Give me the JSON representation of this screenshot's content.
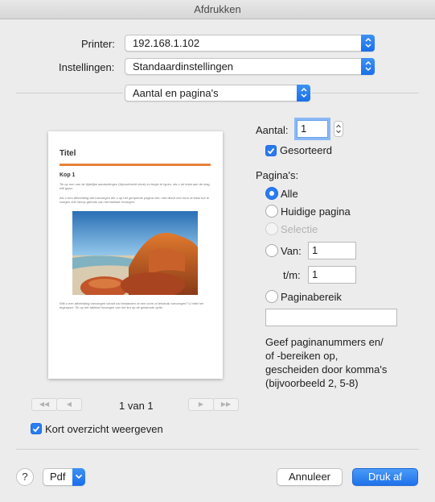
{
  "window": {
    "title": "Afdrukken"
  },
  "printer": {
    "label": "Printer:",
    "value": "192.168.1.102"
  },
  "settings": {
    "label": "Instellingen:",
    "value": "Standaardinstellingen"
  },
  "section": {
    "value": "Aantal en pagina's"
  },
  "copies": {
    "label": "Aantal:",
    "value": "1",
    "collated_label": "Gesorteerd",
    "collated_checked": true
  },
  "pages": {
    "label": "Pagina's:",
    "options": {
      "all": "Alle",
      "current": "Huidige pagina",
      "selection": "Selectie",
      "from": "Van:"
    },
    "selected": "all",
    "from_value": "1",
    "to_label": "t/m:",
    "to_value": "1",
    "range_label": "Paginabereik",
    "range_value": "",
    "hint": "Geef paginanummers en/\nof -bereiken op,\ngescheiden door komma's\n(bijvoorbeeld 2, 5-8)"
  },
  "preview": {
    "doc_title": "Titel",
    "heading": "Kop 1",
    "accent_color": "#e8823a",
    "para1": "Tik op een van de tijdelijke aanduidingen (bijvoorbeeld deze) en begin te typen, als u de tekst aan de slag wilt gaan.",
    "para2": "Als u een afbeelding wilt toevoegen die u op het geopende pagina ziet, met direct een form of tekst toe te voegen zult hierop gebruik van het tabblad Invoegen.",
    "para3": "Wilt u een afbeelding toevoegen vanuit uw bestanden of een vorm of tekstvak toevoegen? U hebt het tegenpart. Tik op het tabblad Invoegen van het lint op de gewenste optie.",
    "page_indicator": "1 van 1"
  },
  "show_summary": {
    "label": "Kort overzicht weergeven",
    "checked": true
  },
  "footer": {
    "help": "?",
    "pdf": "Pdf",
    "cancel": "Annuleer",
    "print": "Druk af"
  },
  "colors": {
    "accent": "#2b7bf0",
    "background": "#ececec"
  }
}
